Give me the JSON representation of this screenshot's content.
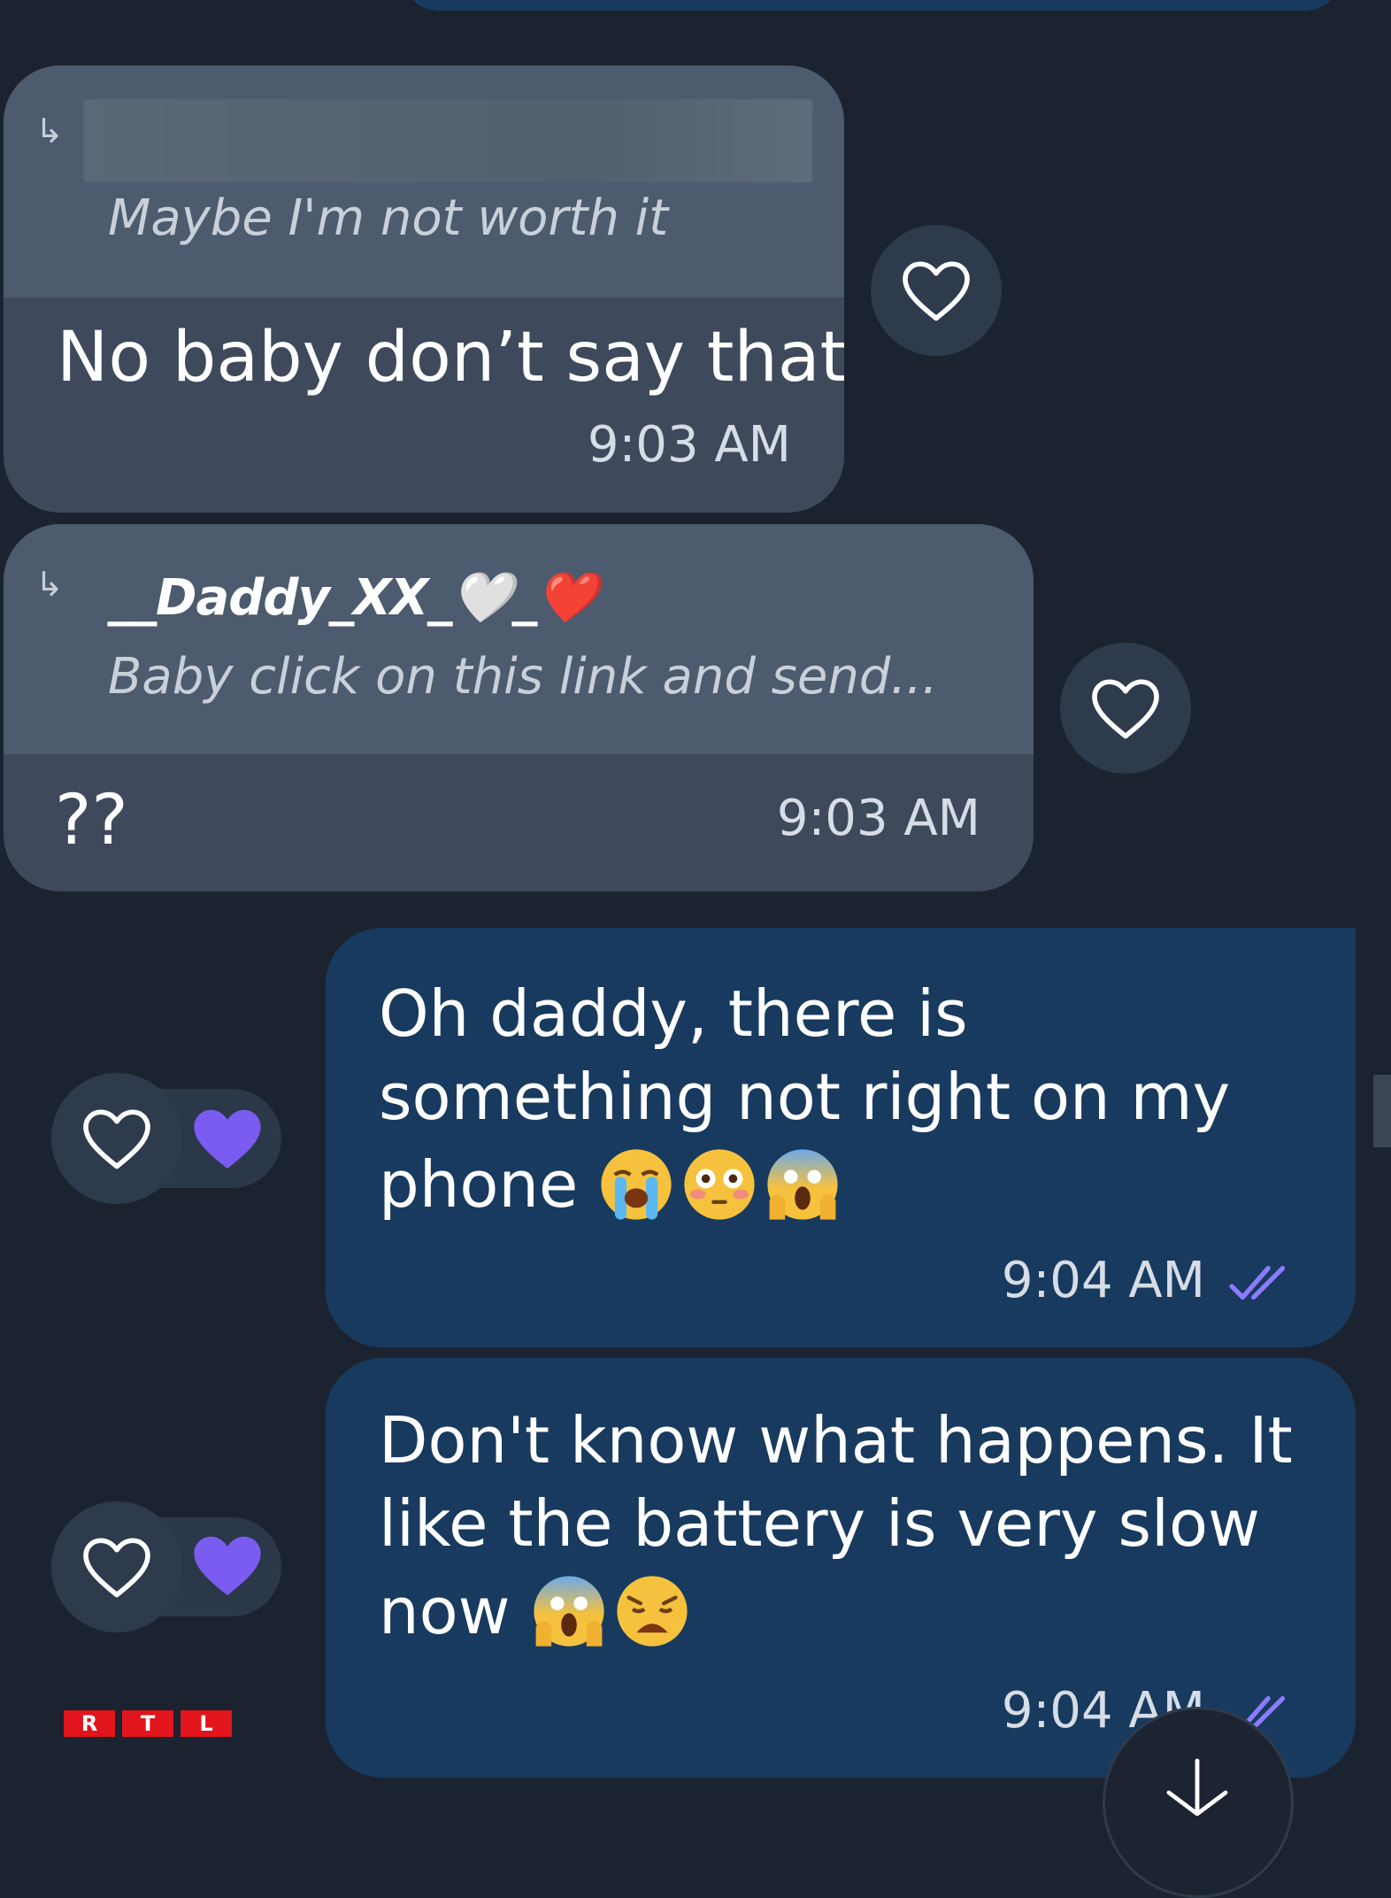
{
  "messages": [
    {
      "direction": "incoming",
      "reply_preview_text": "Maybe I'm not worth it",
      "text": "No baby don’t say that",
      "time": "9:03 AM",
      "reaction_icon": "heart-outline-icon"
    },
    {
      "direction": "incoming",
      "reply_author": "__Daddy_XX_🤍_❤️",
      "reply_preview_text": "Baby click on this link and send...",
      "text": "??",
      "time": "9:03 AM",
      "reaction_icon": "heart-outline-icon"
    },
    {
      "direction": "outgoing",
      "text_lines": [
        "Oh daddy, there is",
        "something not right on my",
        "phone"
      ],
      "emojis": [
        "loudly-crying-face",
        "flushed-face",
        "face-screaming-in-fear"
      ],
      "time": "9:04 AM",
      "status_icon": "double-check-icon",
      "reactions": [
        "heart-outline-icon",
        "purple-heart-icon"
      ]
    },
    {
      "direction": "outgoing",
      "text_lines": [
        "Don't know what happens. It",
        "like the battery is very slow",
        "now"
      ],
      "emojis": [
        "face-screaming-in-fear",
        "weary-face"
      ],
      "time": "9:04 AM",
      "status_icon": "double-check-icon",
      "reactions": [
        "heart-outline-icon",
        "purple-heart-icon"
      ]
    }
  ],
  "watermark": [
    "R",
    "T",
    "L"
  ],
  "colors": {
    "background": "#1c2330",
    "incoming_bubble": "#3e4a5c",
    "outgoing_bubble": "#183a5f",
    "read_check": "#8c7bff",
    "purple_heart": "#7b5cf0",
    "rtl_red": "#e2141c"
  }
}
